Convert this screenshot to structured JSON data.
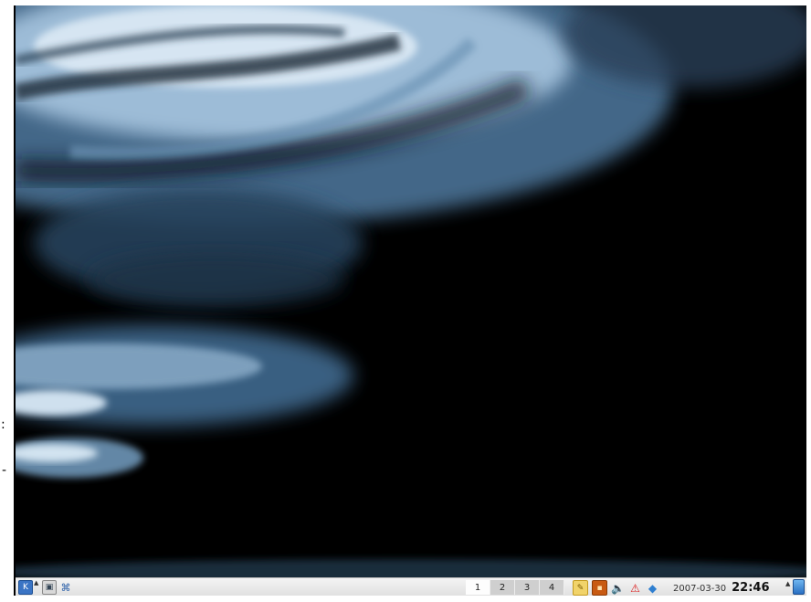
{
  "taskbar": {
    "launcher_icon": "kde-menu-icon",
    "show_desktop_icon": "show-desktop-icon",
    "network_icon": "network-icon",
    "pager": [
      "1",
      "2",
      "3",
      "4"
    ],
    "active_desktop": "1",
    "tray_icons": [
      "klipper-clipboard-icon",
      "kwallet-icon",
      "volume-icon",
      "warning-icon",
      "network-status-icon"
    ],
    "date": "2007-03-30",
    "time": "22:46",
    "trash_icon": "trash-icon"
  },
  "colors": {
    "wallpaper_light": "#b9d3e8",
    "wallpaper_mid": "#5b86ab",
    "wallpaper_dark": "#000000",
    "taskbar_bg": "#e8e8e8"
  }
}
